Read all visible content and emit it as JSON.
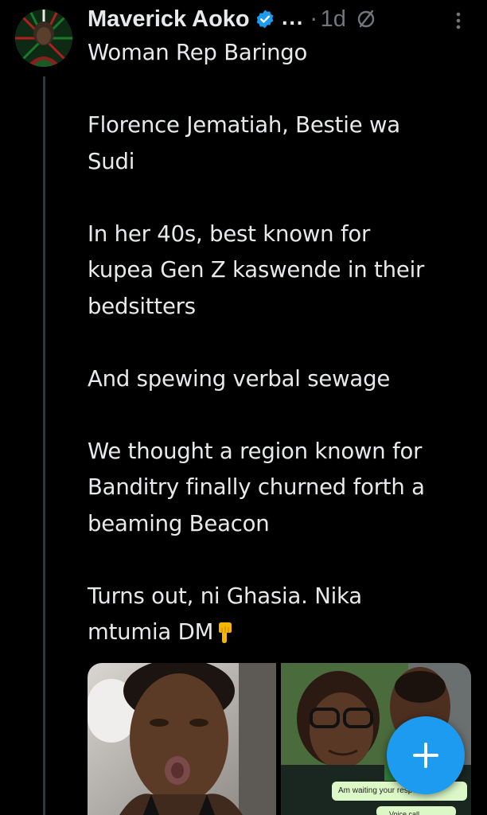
{
  "post": {
    "author": {
      "name": "Maverick Aoko",
      "verified": true,
      "verified_color": "#1d9bf0"
    },
    "ellipsis": "...",
    "separator": "·",
    "timestamp": "1d",
    "reply_restriction_icon": "no-reply-icon",
    "more_icon": "more-vertical-icon",
    "lines": [
      "Woman Rep Baringo",
      "",
      "Florence Jematiah, Bestie wa",
      "Sudi",
      "",
      "In her 40s, best known for",
      "kupea Gen Z kaswende in their",
      "bedsitters",
      "",
      "And spewing verbal sewage",
      "",
      "We thought a region known for",
      "Banditry finally churned forth a",
      "beaming Beacon",
      "",
      "Turns out, ni Ghasia. Nika",
      "mtumia DM"
    ],
    "emoji": "pointing-down-hand-emoji",
    "media": {
      "image_1": "woman-selfie-photo",
      "image_2": "couple-selfie-with-chat-screenshot",
      "chat_text": "Am waiting your respo",
      "chat_text_2": "Voice call"
    }
  },
  "fab": {
    "icon": "plus-icon",
    "color": "#1d9bf0"
  },
  "colors": {
    "background": "#000000",
    "text": "#e7e9ea",
    "secondary": "#71767b",
    "accent": "#1d9bf0",
    "thread_line": "#333639"
  }
}
